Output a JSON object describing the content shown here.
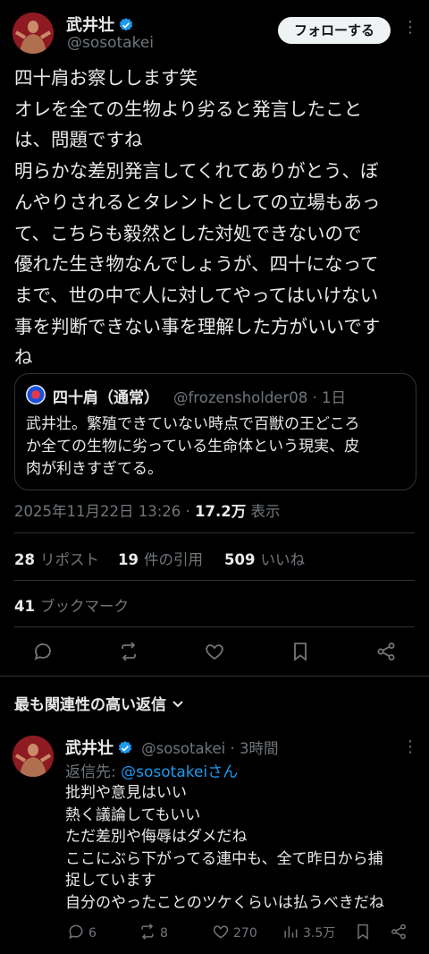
{
  "post": {
    "author_name": "武井壮",
    "author_handle": "@sosotakei",
    "follow_label": "フォローする",
    "body_lines": [
      "四十肩お察しします笑",
      "オレを全ての生物より劣ると発言したこと",
      "は、問題ですね",
      "明らかな差別発言してくれてありがとう、ぼ",
      "んやりされるとタレントとしての立場もあっ",
      "て、こちらも毅然とした対処できないので",
      "優れた生き物なんでしょうが、四十になって",
      "まで、世の中で人に対してやってはいけない",
      "事を判断できない事を理解した方がいいです",
      "ね"
    ],
    "quote": {
      "name": "四十肩（通常）",
      "handle_time": "@frozensholder08 · 1日",
      "lines": [
        "武井壮。繁殖できていない時点で百獣の王どころ",
        "か全ての生物に劣っている生命体という現実、皮",
        "肉が利きすぎてる。"
      ]
    },
    "timestamp": "2025年11月22日 13:26 · ",
    "views_count": "17.2万",
    "views_label": " 表示",
    "stats": {
      "reposts_count": "28",
      "reposts_label": "リポスト",
      "quotes_count": "19",
      "quotes_label": "件の引用",
      "likes_count": "509",
      "likes_label": "いいね",
      "bookmarks_count": "41",
      "bookmarks_label": "ブックマーク"
    },
    "actions": [
      "reply-icon",
      "repost-icon",
      "like-icon",
      "bookmark-icon",
      "share-icon"
    ]
  },
  "replies_section": {
    "sort_label": "最も関連性の高い返信"
  },
  "reply": {
    "author_name": "武井壮",
    "author_handle_time": "@sosotakei · 3時間",
    "reply_to_prefix": "返信先: ",
    "reply_to_handle": "@sosotakei",
    "reply_to_suffix": "さん",
    "lines": [
      "批判や意見はいい",
      "熱く議論してもいい",
      "ただ差別や侮辱はダメだね",
      "ここにぶら下がってる連中も、全て昨日から捕",
      "捉しています",
      "自分のやったことのツケくらいは払うべきだね"
    ],
    "reply_count": "6",
    "repost_count": "8",
    "like_count": "270",
    "views_count": "3.5万"
  },
  "colors": {
    "background": "#000000",
    "text": "#e7e9ea",
    "muted": "#71767b",
    "accent": "#1d9bf0",
    "divider": "#2f3336"
  }
}
